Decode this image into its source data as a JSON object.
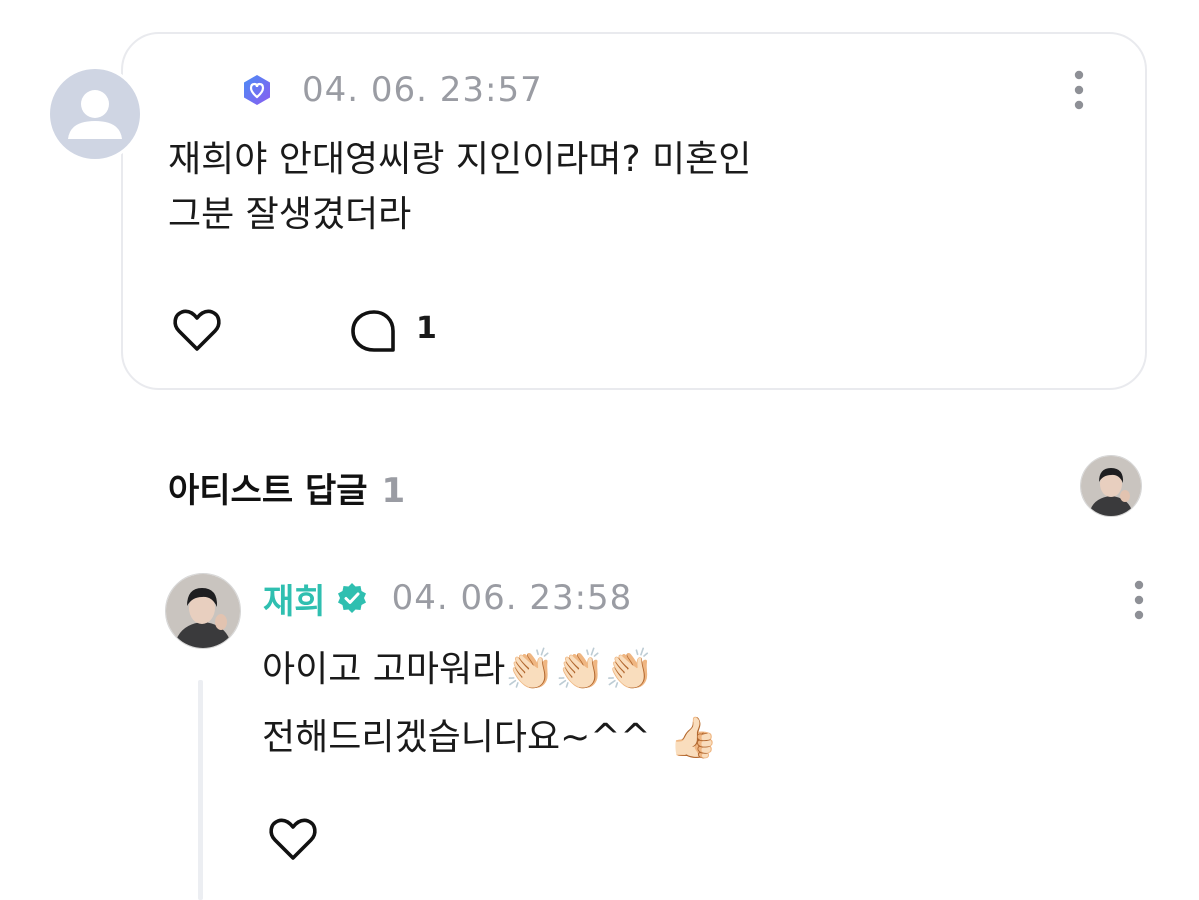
{
  "post": {
    "timestamp": "04. 06. 23:57",
    "body_lines": [
      "재희야 안대영씨랑 지인이라며? 미혼인",
      "그분 잘생겼더라"
    ],
    "comment_count": "1",
    "badge_color": "#5b6cf0",
    "icons": [
      "user-placeholder-icon",
      "membership-badge-icon",
      "more-vertical-icon",
      "heart-icon",
      "comment-bubble-icon"
    ]
  },
  "artist_section": {
    "title": "아티스트 답글",
    "count": "1"
  },
  "reply": {
    "author": "재희",
    "timestamp": "04. 06. 23:58",
    "line1_text": "아이고 고마워라",
    "line1_emoji": "👏🏻👏🏻👏🏻",
    "line2_text": "전해드리겠습니다요~^^",
    "line2_emoji": "👍🏻",
    "name_color": "#2fbfb0",
    "icons": [
      "verified-icon",
      "more-vertical-icon",
      "heart-icon"
    ]
  }
}
